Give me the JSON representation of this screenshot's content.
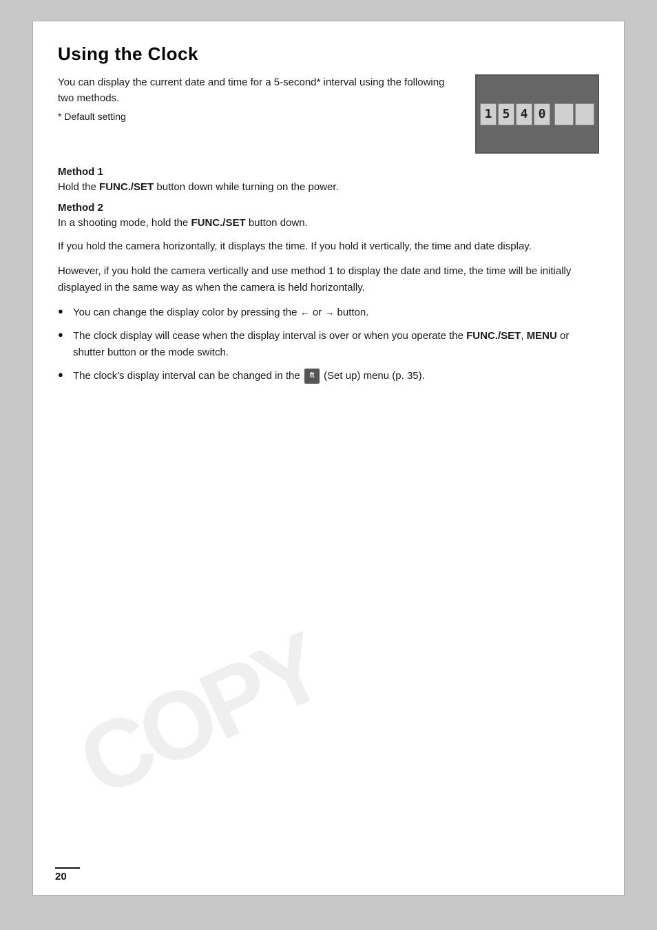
{
  "page": {
    "title": "Using the Clock",
    "page_number": "20"
  },
  "intro": {
    "text": "You can display the current date and time for a 5-second* interval using the following two methods.",
    "asterisk": "* Default setting"
  },
  "clock_display": {
    "digits": [
      "1",
      "5",
      "4",
      "0"
    ],
    "aria": "Clock display showing 15:40"
  },
  "methods": [
    {
      "label": "Method 1",
      "text_before": "Hold the ",
      "func_set": "FUNC./SET",
      "text_after": " button down while turning on the power."
    },
    {
      "label": "Method 2",
      "text_before": "In a shooting mode, hold the ",
      "func_set": "FUNC./SET",
      "text_after": " button down."
    }
  ],
  "body_paragraphs": [
    "If you hold the camera horizontally, it displays the time. If you hold it vertically, the time and date display.",
    "However, if you hold the camera vertically and use method 1 to display the date and time, the time will be initially displayed in the same way as when the camera is held horizontally."
  ],
  "bullets": [
    {
      "text_before": "You can change the display color by pressing the ",
      "arrow_left": "←",
      "or": " or ",
      "arrow_right": "→",
      "text_after": " button."
    },
    {
      "text_before": "The clock display will cease when the display interval is over or when you operate the ",
      "func_set": "FUNC./SET",
      "comma": ", ",
      "menu": "MENU",
      "text_after": " or shutter button or the mode switch."
    },
    {
      "text_before": "The clock's display interval can be changed in the ",
      "setup_icon": "ft",
      "text_after": " (Set up) menu (p. 35)."
    }
  ],
  "watermark": "COPY"
}
